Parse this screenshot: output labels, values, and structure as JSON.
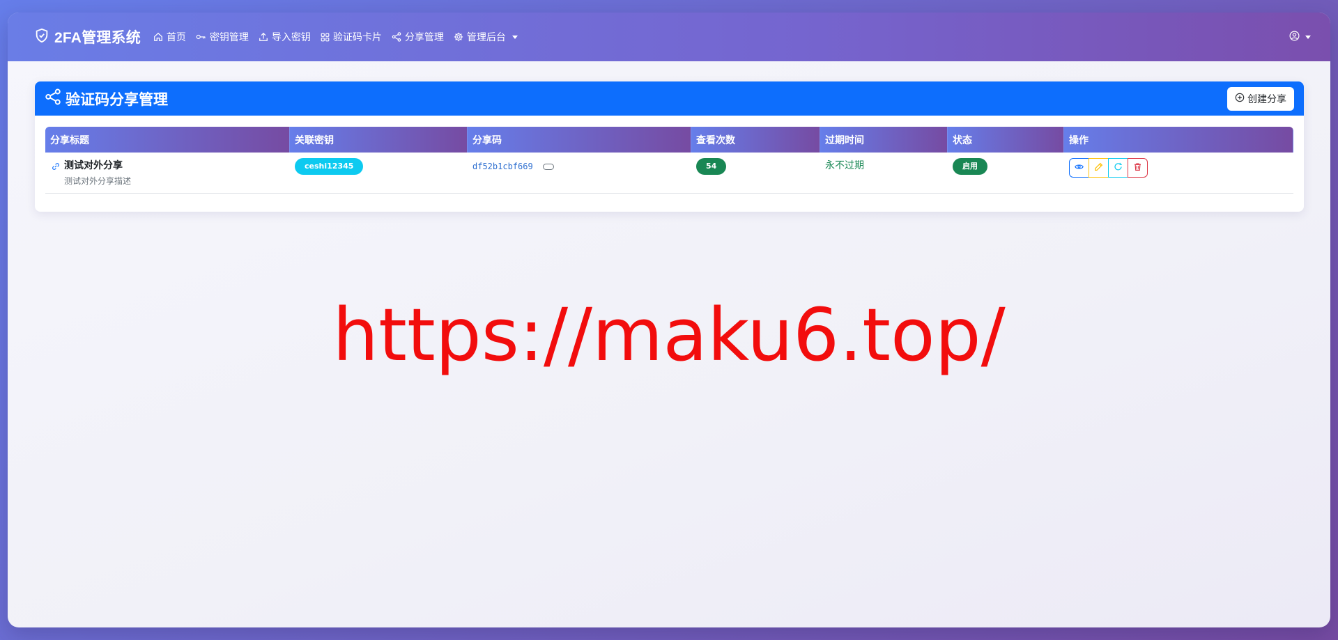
{
  "navbar": {
    "brand": "2FA管理系统",
    "links": [
      {
        "label": "首页",
        "icon": "house-icon"
      },
      {
        "label": "密钥管理",
        "icon": "key-icon"
      },
      {
        "label": "导入密钥",
        "icon": "upload-icon"
      },
      {
        "label": "验证码卡片",
        "icon": "grid-icon"
      },
      {
        "label": "分享管理",
        "icon": "share-icon"
      },
      {
        "label": "管理后台",
        "icon": "gear-icon",
        "dropdown": true
      }
    ],
    "user_icon": "user-circle-icon"
  },
  "card": {
    "title": "验证码分享管理",
    "create_button": "创建分享"
  },
  "table": {
    "headers": [
      "分享标题",
      "关联密钥",
      "分享码",
      "查看次数",
      "过期时间",
      "状态",
      "操作"
    ],
    "rows": [
      {
        "title": "测试对外分享",
        "description": "测试对外分享描述",
        "key": "ceshi12345",
        "code": "df52b1cbf669",
        "views": "54",
        "expire": "永不过期",
        "status": "启用"
      }
    ]
  },
  "watermark": "https://maku6.top/",
  "colors": {
    "primary": "#0d6efd",
    "gradient_start": "#667eea",
    "gradient_end": "#764ba2",
    "success": "#198754",
    "info": "#0dcaf0",
    "warning": "#ffc107",
    "danger": "#dc3545",
    "watermark": "#f20d0d"
  }
}
